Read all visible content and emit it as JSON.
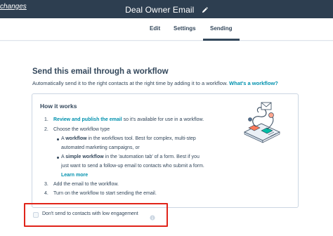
{
  "header": {
    "changes_link": "changes",
    "title": "Deal Owner Email",
    "edit_icon": "pencil-icon"
  },
  "tabs": [
    {
      "label": "Edit"
    },
    {
      "label": "Settings"
    },
    {
      "label": "Sending",
      "active": true
    }
  ],
  "section": {
    "title": "Send this email through a workflow",
    "description": "Automatically send it to the right contacts at the right time by adding it to a workflow.",
    "description_link": "What's a workflow?"
  },
  "how_it_works": {
    "title": "How it works",
    "illustration_icon": "workflow-illustration",
    "step1": {
      "num": "1.",
      "link": "Review and publish the email",
      "text": " so it's available for use in a workflow."
    },
    "step2": {
      "num": "2.",
      "text": "Choose the workflow type"
    },
    "bullet1": {
      "prefix": "A ",
      "bold": "workflow",
      "text": " in the workflows tool. Best for complex, multi-step",
      "line2": "automated marketing campaigns, or"
    },
    "bullet2": {
      "prefix": "A ",
      "bold": "simple workflow",
      "text": " in the 'automation tab' of a form. Best if you",
      "line2": "just want to send a follow-up email to contacts who submit a form.",
      "link": "Learn more"
    },
    "step3": {
      "num": "3.",
      "text": "Add the email to the workflow."
    },
    "step4": {
      "num": "4.",
      "text": "Turn on the workflow to start sending the email."
    }
  },
  "engagement_option": {
    "label": "Don't send to contacts with low engagement",
    "checked": false,
    "info_icon": "info-icon"
  },
  "colors": {
    "topbar": "#2d3e50",
    "link": "#0091ae",
    "text": "#33475b",
    "highlight": "#e0241a"
  }
}
